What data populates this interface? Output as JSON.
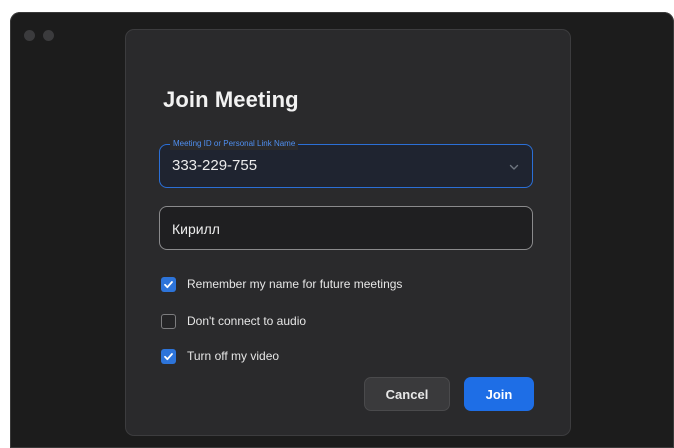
{
  "window": {
    "title_bar_buttons": [
      "close",
      "minimize"
    ]
  },
  "dialog": {
    "title": "Join Meeting",
    "meeting_field": {
      "label": "Meeting ID or Personal Link Name",
      "value": "333-229-755",
      "icon": "chevron-down-icon"
    },
    "name_field": {
      "value": "Кирилл"
    },
    "options": [
      {
        "label": "Remember my name for future meetings",
        "checked": true
      },
      {
        "label": "Don't connect to audio",
        "checked": false
      },
      {
        "label": "Turn off my video",
        "checked": true
      }
    ],
    "buttons": {
      "cancel_label": "Cancel",
      "join_label": "Join"
    }
  },
  "colors": {
    "accent": "#1e6ee6",
    "dialog_bg": "#2a2a2c",
    "window_bg": "#1c1c1c"
  }
}
